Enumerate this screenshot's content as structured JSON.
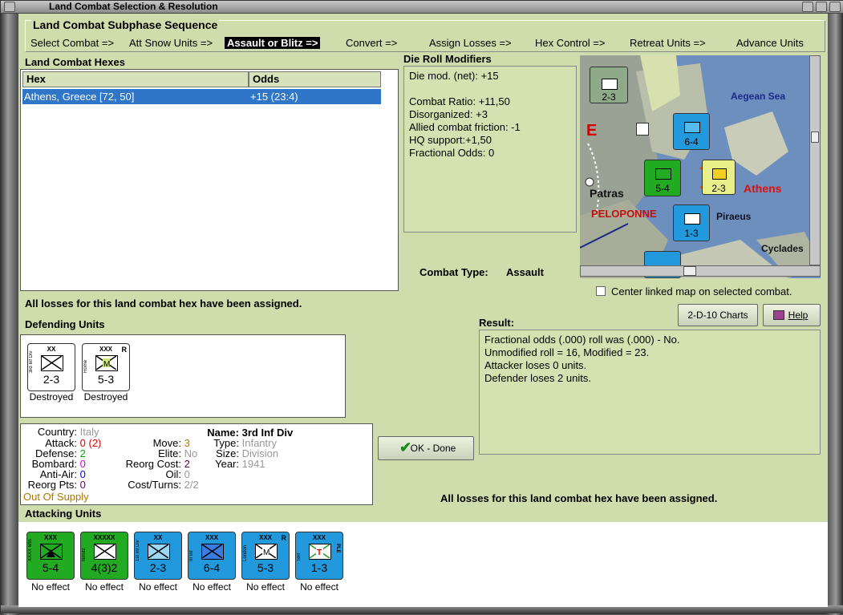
{
  "window": {
    "title": "Land Combat Selection & Resolution"
  },
  "sequence": {
    "title": "Land Combat Subphase Sequence",
    "steps": [
      "Select Combat =>",
      "Att Snow Units =>",
      "Assault or Blitz =>",
      "Convert =>",
      "Assign Losses =>",
      "Hex Control =>",
      "Retreat Units =>",
      "Advance Units"
    ],
    "active_index": 2
  },
  "hexes": {
    "title": "Land Combat Hexes",
    "columns": [
      "Hex",
      "Odds"
    ],
    "rows": [
      {
        "hex": "Athens, Greece [72, 50]",
        "odds": "+15 (23:4)"
      }
    ]
  },
  "modifiers": {
    "title": "Die Roll Modifiers",
    "lines": [
      "Die mod. (net): +15",
      "",
      "Combat Ratio: +11,50",
      "Disorganized: +3",
      "Allied combat friction: -1",
      "HQ support:+1,50",
      "Fractional Odds: 0"
    ]
  },
  "combat_type": {
    "label": "Combat Type:",
    "value": "Assault"
  },
  "map": {
    "labels": [
      "Aegean Sea",
      "Athens",
      "Piraeus",
      "Patras",
      "PELOPONNE",
      "Cyclades"
    ],
    "center_checkbox": {
      "label": "Center linked map on selected combat.",
      "checked": false
    }
  },
  "losses_msg_1": "All losses for this land combat hex have been assigned.",
  "buttons": {
    "charts": "2-D-10 Charts",
    "help": "Help",
    "ok": "OK - Done"
  },
  "defending": {
    "title": "Defending Units",
    "units": [
      {
        "size": "XX",
        "side": "3rd Inf Div",
        "value": "2-3",
        "status": "Destroyed",
        "color": "#cde87a",
        "symbol": "infantry",
        "reserve": ""
      },
      {
        "size": "XXX",
        "side": "Rome",
        "value": "5-3",
        "status": "Destroyed",
        "color": "#cde87a",
        "symbol": "mech",
        "reserve": "R"
      }
    ]
  },
  "result": {
    "title": "Result:",
    "lines": [
      "Fractional odds (.000) roll was (.000)  - No.",
      "Unmodified roll = 16, Modified = 23.",
      "Attacker loses 0 units.",
      "Defender loses 2 units."
    ]
  },
  "unit_info": {
    "country_label": "Country:",
    "country": "Italy",
    "attack_label": "Attack:",
    "attack": "0",
    "attack_extra": "(2)",
    "defense_label": "Defense:",
    "defense": "2",
    "bombard_label": "Bombard:",
    "bombard": "0",
    "antiair_label": "Anti-Air:",
    "antiair": "0",
    "reorg_pts_label": "Reorg Pts:",
    "reorg_pts": "0",
    "supply": "Out Of Supply",
    "move_label": "Move:",
    "move": "3",
    "elite_label": "Elite:",
    "elite": "No",
    "reorg_cost_label": "Reorg Cost:",
    "reorg_cost": "2",
    "oil_label": "Oil:",
    "oil": "0",
    "cost_turns_label": "Cost/Turns:",
    "cost_turns": "2/2",
    "name_label": "Name:",
    "name": "3rd Inf Div",
    "type_label": "Type:",
    "type": "Infantry",
    "size_label": "Size:",
    "size": "Division",
    "year_label": "Year:",
    "year": "1941"
  },
  "losses_msg_2": "All losses for this land combat hex have been assigned.",
  "attacking": {
    "title": "Attacking Units",
    "units": [
      {
        "size": "XXX",
        "side": "XXXX Mtn",
        "value": "5-4",
        "status": "No effect",
        "color": "#22aa22",
        "symbol": "mountain",
        "reserve": ""
      },
      {
        "size": "XXXXX",
        "side": "Nimitz",
        "value": "4(3)2",
        "status": "No effect",
        "color": "#22aa22",
        "symbol": "infantry",
        "reserve": ""
      },
      {
        "size": "XX",
        "side": "1st Inf Div",
        "value": "2-3",
        "status": "No effect",
        "color": "#2299dd",
        "symbol": "infantry",
        "reserve": ""
      },
      {
        "size": "XXX",
        "side": "III Inf",
        "value": "6-4",
        "status": "No effect",
        "color": "#2299dd",
        "symbol": "infantry",
        "reserve": ""
      },
      {
        "size": "XXX",
        "side": "London",
        "value": "5-3",
        "status": "No effect",
        "color": "#2299dd",
        "symbol": "mech",
        "reserve": "R"
      },
      {
        "size": "XXX",
        "side": "Terr",
        "value": "1-3",
        "status": "No effect",
        "color": "#2299dd",
        "symbol": "territorial",
        "reserve": "PLE"
      }
    ]
  },
  "colors": {
    "panel_green": "#cfdcab",
    "selection_blue": "#2f75c8"
  }
}
